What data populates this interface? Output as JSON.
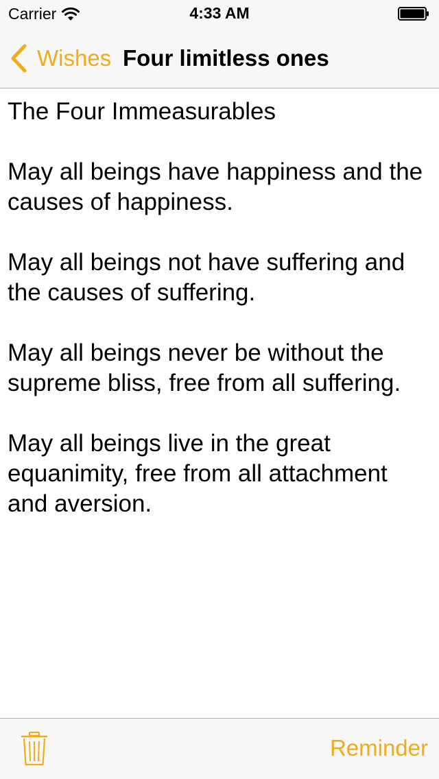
{
  "status_bar": {
    "carrier": "Carrier",
    "time": "4:33 AM",
    "wifi_icon": "wifi-icon",
    "battery_icon": "battery-full-icon"
  },
  "nav": {
    "back_label": "Wishes",
    "back_icon": "chevron-left-icon",
    "title": "Four limitless ones",
    "accent_color": "#f0ac1a"
  },
  "content": {
    "heading": "The Four Immeasurables",
    "paragraphs": [
      "May all beings have happiness and the causes of happiness.",
      "May all beings not have suffering and the causes of suffering.",
      "May all beings never be without the supreme bliss, free from all suffering.",
      "May all beings live in the great equanimity, free from all attachment and aversion."
    ]
  },
  "toolbar": {
    "trash_icon": "trash-icon",
    "reminder_label": "Reminder"
  }
}
